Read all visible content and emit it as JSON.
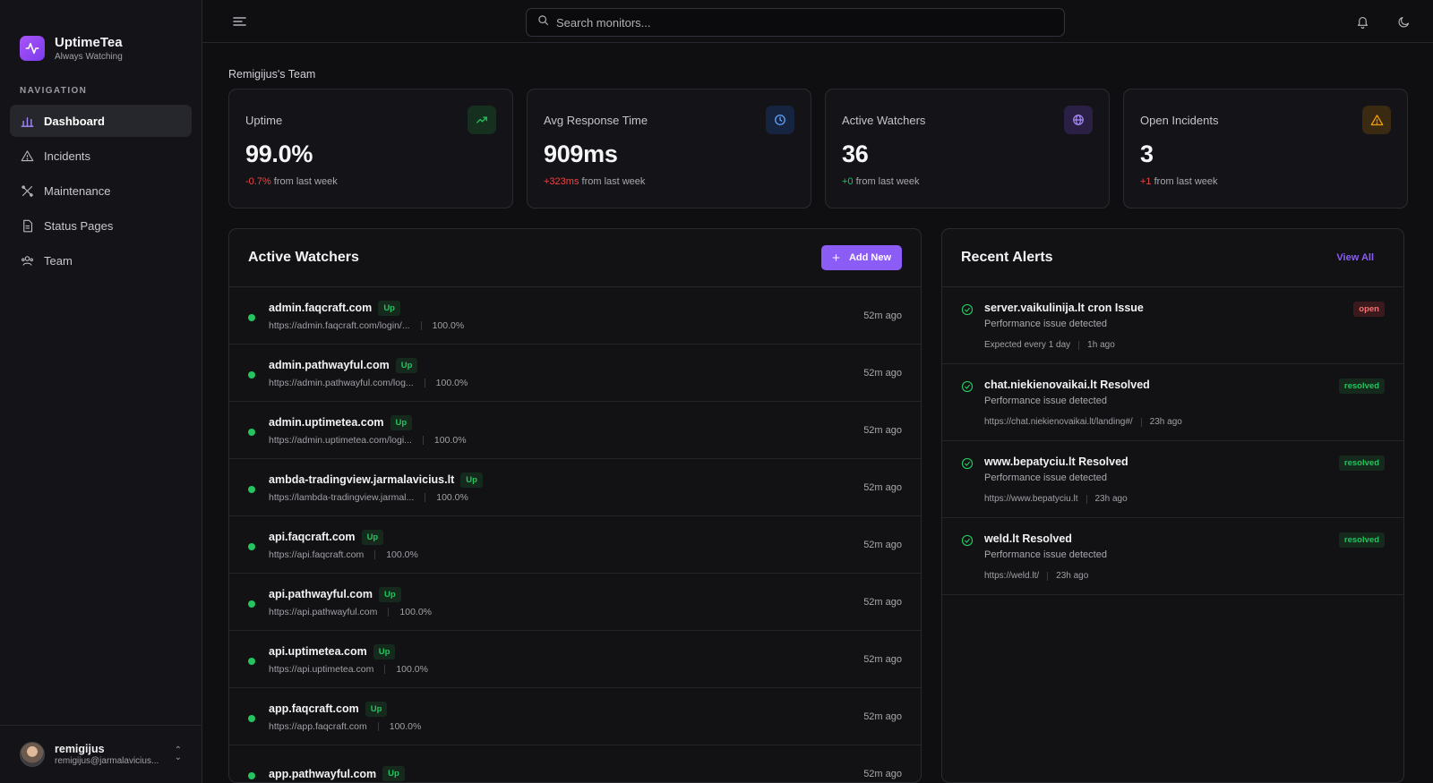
{
  "brand": {
    "name": "UptimeTea",
    "tagline": "Always Watching"
  },
  "nav": {
    "heading": "NAVIGATION",
    "items": [
      {
        "label": "Dashboard",
        "icon": "bar-chart-icon",
        "active": true
      },
      {
        "label": "Incidents",
        "icon": "warning-icon"
      },
      {
        "label": "Maintenance",
        "icon": "tools-icon"
      },
      {
        "label": "Status Pages",
        "icon": "document-icon"
      },
      {
        "label": "Team",
        "icon": "team-icon"
      }
    ]
  },
  "user": {
    "name": "remigijus",
    "email": "remigijus@jarmalavicius..."
  },
  "search": {
    "placeholder": "Search monitors..."
  },
  "team_name": "Remigijus's Team",
  "stats": [
    {
      "label": "Uptime",
      "value": "99.0%",
      "change": "-0.7%",
      "change_suffix": " from last week",
      "icon": "trending-up-icon",
      "accent": "#22c55e"
    },
    {
      "label": "Avg Response Time",
      "value": "909ms",
      "change": "+323ms",
      "change_suffix": " from last week",
      "icon": "clock-icon",
      "accent": "#3b82f6"
    },
    {
      "label": "Active Watchers",
      "value": "36",
      "change": "+0",
      "change_suffix": " from last week",
      "icon": "globe-icon",
      "accent": "#8b5cf6"
    },
    {
      "label": "Open Incidents",
      "value": "3",
      "change": "+1",
      "change_suffix": " from last week",
      "icon": "alert-triangle-icon",
      "accent": "#f59e0b"
    }
  ],
  "watchers_panel": {
    "title": "Active Watchers",
    "add_label": "Add New",
    "rows": [
      {
        "name": "admin.faqcraft.com",
        "status": "Up",
        "url": "https://admin.faqcraft.com/login/...",
        "uptime": "100.0%",
        "time": "52m ago"
      },
      {
        "name": "admin.pathwayful.com",
        "status": "Up",
        "url": "https://admin.pathwayful.com/log...",
        "uptime": "100.0%",
        "time": "52m ago"
      },
      {
        "name": "admin.uptimetea.com",
        "status": "Up",
        "url": "https://admin.uptimetea.com/logi...",
        "uptime": "100.0%",
        "time": "52m ago"
      },
      {
        "name": "ambda-tradingview.jarmalavicius.lt",
        "status": "Up",
        "url": "https://lambda-tradingview.jarmal...",
        "uptime": "100.0%",
        "time": "52m ago"
      },
      {
        "name": "api.faqcraft.com",
        "status": "Up",
        "url": "https://api.faqcraft.com",
        "uptime": "100.0%",
        "time": "52m ago"
      },
      {
        "name": "api.pathwayful.com",
        "status": "Up",
        "url": "https://api.pathwayful.com",
        "uptime": "100.0%",
        "time": "52m ago"
      },
      {
        "name": "api.uptimetea.com",
        "status": "Up",
        "url": "https://api.uptimetea.com",
        "uptime": "100.0%",
        "time": "52m ago"
      },
      {
        "name": "app.faqcraft.com",
        "status": "Up",
        "url": "https://app.faqcraft.com",
        "uptime": "100.0%",
        "time": "52m ago"
      },
      {
        "name": "app.pathwayful.com",
        "status": "Up",
        "url": "",
        "uptime": "",
        "time": "52m ago"
      }
    ]
  },
  "alerts_panel": {
    "title": "Recent Alerts",
    "view_all_label": "View All",
    "rows": [
      {
        "title": "server.vaikulinija.lt cron Issue",
        "desc": "Performance issue detected",
        "meta1": "Expected every 1 day",
        "meta2": "1h ago",
        "badge": "open"
      },
      {
        "title": "chat.niekienovaikai.lt Resolved",
        "desc": "Performance issue detected",
        "meta1": "https://chat.niekienovaikai.lt/landing#/",
        "meta2": "23h ago",
        "badge": "resolved"
      },
      {
        "title": "www.bepatyciu.lt Resolved",
        "desc": "Performance issue detected",
        "meta1": "https://www.bepatyciu.lt",
        "meta2": "23h ago",
        "badge": "resolved"
      },
      {
        "title": "weld.lt Resolved",
        "desc": "Performance issue detected",
        "meta1": "https://weld.lt/",
        "meta2": "23h ago",
        "badge": "resolved"
      }
    ]
  }
}
